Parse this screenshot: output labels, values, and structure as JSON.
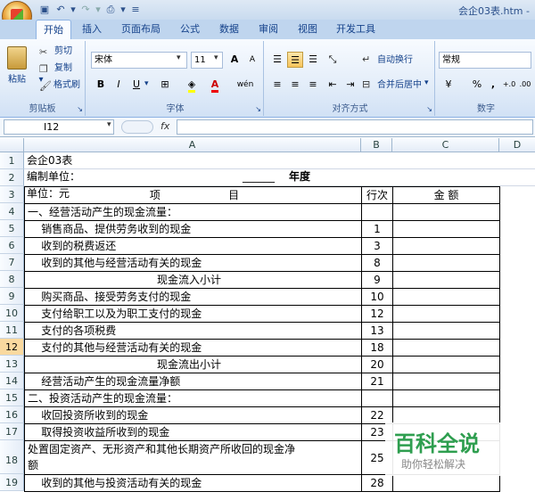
{
  "doc_title": "会企03表.htm -",
  "tabs": [
    "开始",
    "插入",
    "页面布局",
    "公式",
    "数据",
    "审阅",
    "视图",
    "开发工具"
  ],
  "clipboard": {
    "paste": "粘贴",
    "cut": "剪切",
    "copy": "复制",
    "format_painter": "格式刷",
    "label": "剪贴板"
  },
  "font": {
    "name": "宋体",
    "size": "11",
    "bold": "B",
    "italic": "I",
    "underline": "U",
    "wen": "wén",
    "label": "字体",
    "grow": "A",
    "shrink": "A"
  },
  "alignment": {
    "wrap": "自动换行",
    "merge": "合并后居中",
    "label": "对齐方式"
  },
  "number": {
    "format": "常规",
    "percent": "%",
    "comma": ",",
    "label": "数字",
    "inc": "+.0",
    "dec": ".00"
  },
  "formula_bar": {
    "name_box": "I12",
    "fx": "fx"
  },
  "columns": [
    "A",
    "B",
    "C",
    "D"
  ],
  "rows": [
    {
      "n": "1",
      "a": "会企03表",
      "b": "",
      "c": ""
    },
    {
      "n": "2",
      "a": "单位：元",
      "b": "",
      "c": ""
    },
    {
      "n": "3",
      "a": "项                    目",
      "b": "行次",
      "c": "金    额"
    },
    {
      "n": "4",
      "a": "一、经营活动产生的现金流量：",
      "b": "",
      "c": ""
    },
    {
      "n": "5",
      "a": "    销售商品、提供劳务收到的现金",
      "b": "1",
      "c": ""
    },
    {
      "n": "6",
      "a": "    收到的税费返还",
      "b": "3",
      "c": ""
    },
    {
      "n": "7",
      "a": "    收到的其他与经营活动有关的现金",
      "b": "8",
      "c": ""
    },
    {
      "n": "8",
      "a": "现金流入小计",
      "b": "9",
      "c": ""
    },
    {
      "n": "9",
      "a": "    购买商品、接受劳务支付的现金",
      "b": "10",
      "c": ""
    },
    {
      "n": "10",
      "a": "    支付给职工以及为职工支付的现金",
      "b": "12",
      "c": ""
    },
    {
      "n": "11",
      "a": "    支付的各项税费",
      "b": "13",
      "c": ""
    },
    {
      "n": "12",
      "a": "    支付的其他与经营活动有关的现金",
      "b": "18",
      "c": ""
    },
    {
      "n": "13",
      "a": "现金流出小计",
      "b": "20",
      "c": ""
    },
    {
      "n": "14",
      "a": "    经营活动产生的现金流量净额",
      "b": "21",
      "c": ""
    },
    {
      "n": "15",
      "a": "二、投资活动产生的现金流量：",
      "b": "",
      "c": ""
    },
    {
      "n": "16",
      "a": "    收回投资所收到的现金",
      "b": "22",
      "c": ""
    },
    {
      "n": "17",
      "a": "    取得投资收益所收到的现金",
      "b": "23",
      "c": ""
    },
    {
      "n": "18",
      "a": "    处置固定资产、无形资产和其他长期资产所收回的现金净",
      "a2": "额",
      "b": "25",
      "c": ""
    },
    {
      "n": "19",
      "a": "    收到的其他与投资活动有关的现金",
      "b": "28",
      "c": ""
    }
  ],
  "sheet_extra": {
    "compile_unit": "编制单位：",
    "year_blank": "______",
    "year": "年度"
  },
  "watermark": {
    "title": "百科全说",
    "subtitle": "助你轻松解决"
  }
}
